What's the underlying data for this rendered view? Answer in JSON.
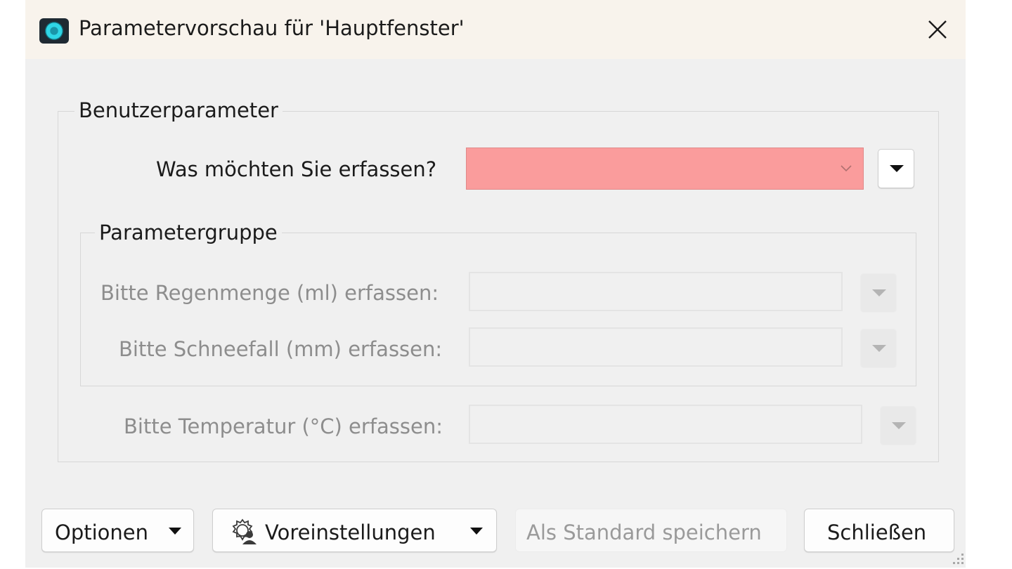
{
  "window": {
    "title": "Parametervorschau für 'Hauptfenster'"
  },
  "user_params": {
    "group_label": "Benutzerparameter",
    "main_field_label": "Was möchten Sie erfassen?",
    "main_field_value": "",
    "main_field_color": "#fa9c9c"
  },
  "param_group": {
    "group_label": "Parametergruppe",
    "fields": [
      {
        "label": "Bitte Regenmenge (ml) erfassen:",
        "value": ""
      },
      {
        "label": "Bitte Schneefall (mm) erfassen:",
        "value": ""
      }
    ]
  },
  "temperature_field": {
    "label": "Bitte Temperatur (°C) erfassen:",
    "value": ""
  },
  "buttons": {
    "options": "Optionen",
    "presets": "Voreinstellungen",
    "save_default": "Als Standard speichern",
    "close": "Schließen"
  }
}
